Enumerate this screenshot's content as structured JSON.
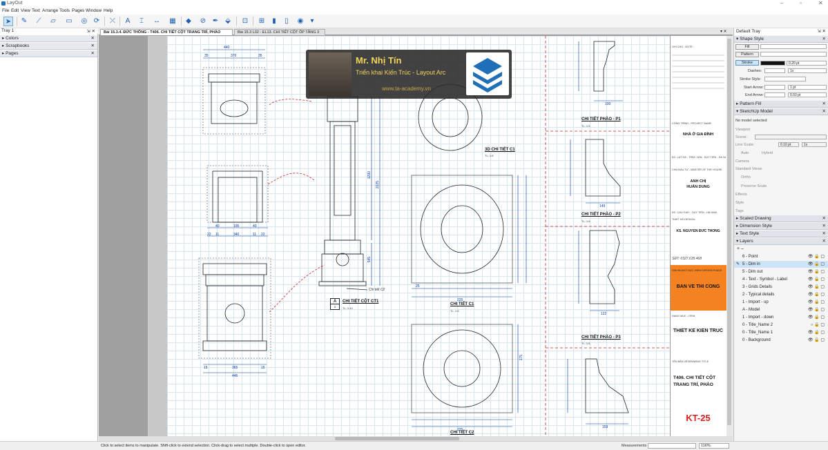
{
  "app": {
    "title": "LayOut",
    "window_controls": [
      "–",
      "▫",
      "✕"
    ]
  },
  "menu": [
    "File",
    "Edit",
    "View",
    "Text",
    "Arrange",
    "Tools",
    "Pages",
    "Window",
    "Help"
  ],
  "tray_left": {
    "title": "Tray 1",
    "pin": "⇲ ✕",
    "panels": [
      "Colors",
      "Scrapbooks",
      "Pages"
    ]
  },
  "tabs": [
    {
      "label": "Bài 15.3.4. ĐỨC THÔNG - T406. CHI TIẾT CỘT TRANG TRÍ, PHÀO"
    },
    {
      "label": "Bài 15.3 L02 - EL13. CHI TIẾT CỘT ỐP TẦNG 3"
    }
  ],
  "banner": {
    "name": "Mr. Nhị Tín",
    "subtitle": "Triển khai Kiến Trúc - Layout Arc",
    "website": "www.ta-academy.vn"
  },
  "drawing": {
    "labels": {
      "detail_3d": "3D CHI TIẾT C1",
      "detail_3d_scale": "TL: 1:5",
      "column_code": "A",
      "column_num": "1",
      "column": "CHI TIẾT CỘT CT1",
      "column_scale": "TL: 1:10",
      "c1": "CHI TIẾT C1",
      "c1_scale": "TL: 1:5",
      "c2": "CHI TIẾT C2",
      "p1": "CHI TIẾT PHÀO - P1",
      "p1_scale": "TL: 1:5",
      "p2": "CHI TIẾT PHÀO - P2",
      "p2_scale": "TL: 1:5",
      "p3": "CHI TIẾT PHÀO - P3",
      "p3_scale": "TL: 1:5",
      "chi_tiet_c2_note": "Chi tiết C2"
    },
    "dims": {
      "top_440": "440",
      "top_370": "370",
      "top_35a": "35",
      "top_35b": "35",
      "mid_40a": "40",
      "mid_195": "195",
      "mid_40b": "40",
      "mid_340": "340",
      "mid_22": "22",
      "mid_11a": "11",
      "mid_11b": "11",
      "mid_22b": "22",
      "bot_365": "365",
      "bot_445": "445",
      "bot_15a": "15",
      "bot_15b": "15",
      "col_1290": "1290",
      "col_2225": "2225",
      "col_545": "545",
      "c1_225": "225",
      "c2_225": "225",
      "c1_25": "25",
      "c1_175": "175",
      "p1_100": "100",
      "p2_149": "149",
      "p3_122": "122",
      "pb_159": "159"
    }
  },
  "title_block": {
    "note_label": "GHI CHÚ - NOTE :",
    "project_label": "CÔNG TRÌNH - PROJECT NAME",
    "project": "NHÀ Ở GIA ĐÌNH",
    "location": "ĐC: LẠT HÀ - TRẮC VĂN - DUY TIÊN - HÀ NAM",
    "owner_label": "CHỦ ĐẦU TƯ - MASTER OF THE HOUSE",
    "owner1": "ANH CHỊ",
    "owner2": "HUẤN DUNG",
    "address": "ĐC: CẦU GIẤY - DUY TIÊN - HÀ NAM",
    "designer_label": "THIẾT KẾ-DESIGN:",
    "designer": "KS. NGUYỄN ĐỨC THÔNG",
    "phone": "SĐT: 0327.635.468",
    "stage_label": "GIAI ĐOẠN THỰC HIỆN/ DESIGN PHASE",
    "stage": "BẢN VẼ THI CÔNG",
    "category_label": "HẠNG MỤC - ITEM",
    "category": "THIẾT KẾ KIẾN TRÚC",
    "drawing_label": "TÊN BẢN VẼ/DRAWING TITLE",
    "drawing1": "T406. CHI TIẾT CỘT",
    "drawing2": "TRANG TRÍ, PHÀO",
    "code": "KT-25"
  },
  "tray_right": {
    "title": "Default Tray",
    "shape_style": {
      "header": "Shape Style",
      "fill": "Fill",
      "pattern": "Pattern",
      "stroke": "Stroke",
      "stroke_w": "0.20 pt",
      "dashes": "Dashes:",
      "dash_scale": "1x",
      "stroke_style": "Stroke Style:",
      "start_arrow": "Start Arrow:",
      "start_val": "1 pt",
      "end_arrow": "End Arrow:",
      "end_val": "0.50 pt"
    },
    "pattern_fill": "Pattern Fill",
    "sketchup_model": {
      "header": "SketchUp Model",
      "status": "No model selected",
      "viewport": "Viewport",
      "scene": "Scene:",
      "line_scale": "Line Scale:",
      "line_val": "0.10 pt",
      "line_x": "1x",
      "auto": "Auto",
      "hybrid": "Hybrid",
      "camera": "Camera",
      "std_views": "Standard Views",
      "ortho": "Ortho",
      "preserve": "Preserve Scale",
      "effects": "Effects",
      "style": "Style",
      "tags": "Tags"
    },
    "scaled_drawing": "Scaled Drawing",
    "dimension_style": "Dimension Style",
    "text_style": "Text Style",
    "layers_header": "Layers",
    "layers_tools": "+  –",
    "layers": [
      "6 - Point",
      "5 - Dim in",
      "5 - Dim out",
      "4 - Text - Symbol - Label",
      "3 - Grids Details",
      "2 - Typical details",
      "1 - Import - up",
      "A - Model",
      "1 - Import - down",
      "0 - Title_Name 2",
      "0 - Title_Name 1",
      "0 - Background"
    ],
    "selected_layer": "5 - Dim in"
  },
  "status": {
    "message": "Click to select items to manipulate. Shift-click to extend selection. Click-drag to select multiple. Double-click to open editor.",
    "measurements": "Measurements",
    "zoom": "116%"
  }
}
